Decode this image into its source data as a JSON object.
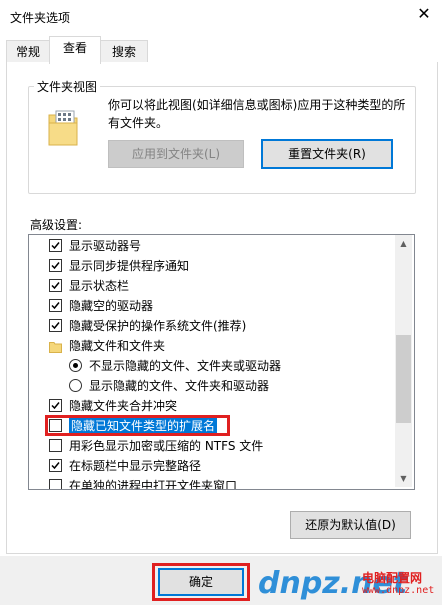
{
  "window": {
    "title": "文件夹选项",
    "close_glyph": "✕"
  },
  "tabs": [
    {
      "label": "常规"
    },
    {
      "label": "查看"
    },
    {
      "label": "搜索"
    }
  ],
  "folder_views": {
    "legend": "文件夹视图",
    "description": "你可以将此视图(如详细信息或图标)应用于这种类型的所有文件夹。",
    "apply_button": "应用到文件夹(L)",
    "reset_button": "重置文件夹(R)",
    "icon": "folder-view-icon"
  },
  "advanced": {
    "label": "高级设置:",
    "items": [
      {
        "type": "checkbox",
        "checked": true,
        "label": "显示驱动器号"
      },
      {
        "type": "checkbox",
        "checked": true,
        "label": "显示同步提供程序通知"
      },
      {
        "type": "checkbox",
        "checked": true,
        "label": "显示状态栏"
      },
      {
        "type": "checkbox",
        "checked": true,
        "label": "隐藏空的驱动器"
      },
      {
        "type": "checkbox",
        "checked": true,
        "label": "隐藏受保护的操作系统文件(推荐)"
      },
      {
        "type": "folder",
        "label": "隐藏文件和文件夹"
      },
      {
        "type": "radio",
        "checked": true,
        "label": "不显示隐藏的文件、文件夹或驱动器"
      },
      {
        "type": "radio",
        "checked": false,
        "label": "显示隐藏的文件、文件夹和驱动器"
      },
      {
        "type": "checkbox",
        "checked": true,
        "label": "隐藏文件夹合并冲突"
      },
      {
        "type": "checkbox",
        "checked": false,
        "label": "隐藏已知文件类型的扩展名",
        "selected": true
      },
      {
        "type": "checkbox",
        "checked": false,
        "label": "用彩色显示加密或压缩的 NTFS 文件"
      },
      {
        "type": "checkbox",
        "checked": true,
        "label": "在标题栏中显示完整路径"
      },
      {
        "type": "checkbox",
        "checked": false,
        "label": "在单独的进程中打开文件夹窗口"
      }
    ]
  },
  "restore_button": "还原为默认值(D)",
  "ok_button": "确定",
  "watermark": {
    "logo": "dnpz.net",
    "cn": "电脑配置网",
    "url": "www.dnpz.net"
  },
  "colors": {
    "accent": "#0078d7",
    "highlight": "#e02020"
  }
}
